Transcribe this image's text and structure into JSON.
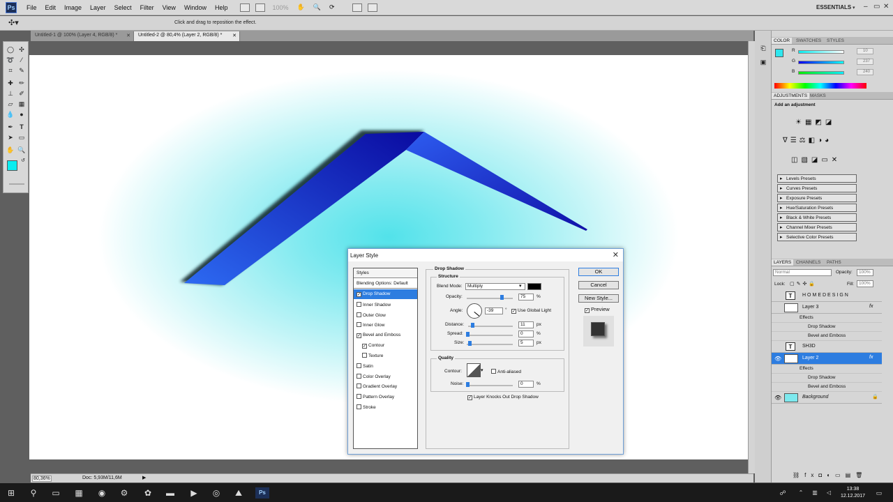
{
  "app": {
    "logo": "Ps",
    "workspace": "ESSENTIALS"
  },
  "menu": [
    "File",
    "Edit",
    "Image",
    "Layer",
    "Select",
    "Filter",
    "View",
    "Window",
    "Help"
  ],
  "zoom_display": "100%",
  "options_hint": "Click and drag to reposition the effect.",
  "tabs": [
    {
      "label": "Untitled-1 @ 100% (Layer 4, RGB/8) *"
    },
    {
      "label": "Untitled-2 @ 80,4% (Layer 2, RGB/8) *"
    }
  ],
  "status": {
    "zoom": "80,36%",
    "doc": "Doc: 5,93M/11,6M"
  },
  "color_panel": {
    "tabs": [
      "COLOR",
      "SWATCHES",
      "STYLES"
    ],
    "r_label": "R",
    "g_label": "G",
    "b_label": "B",
    "r": "10",
    "g": "237",
    "b": "240",
    "foreground": "#0aedf0"
  },
  "adjustments_panel": {
    "tabs": [
      "ADJUSTMENTS",
      "MASKS"
    ],
    "heading": "Add an adjustment",
    "presets": [
      "Levels Presets",
      "Curves Presets",
      "Exposure Presets",
      "Hue/Saturation Presets",
      "Black & White Presets",
      "Channel Mixer Presets",
      "Selective Color Presets"
    ]
  },
  "layers_panel": {
    "tabs": [
      "LAYERS",
      "CHANNELS",
      "PATHS"
    ],
    "blend_mode": "Normal",
    "opacity_label": "Opacity:",
    "opacity": "100%",
    "lock_label": "Lock:",
    "fill_label": "Fill:",
    "fill": "100%",
    "layers": [
      {
        "name": "HOMEDESIGN",
        "fx": ""
      },
      {
        "name": "Layer 3",
        "fx": "fx",
        "effects_label": "Effects",
        "effects": [
          "Drop Shadow",
          "Bevel and Emboss"
        ]
      },
      {
        "name": "SH3D",
        "fx": ""
      },
      {
        "name": "Layer 2",
        "fx": "fx",
        "effects_label": "Effects",
        "effects": [
          "Drop Shadow",
          "Bevel and Emboss"
        ]
      },
      {
        "name": "Background",
        "fx": ""
      }
    ]
  },
  "dialog": {
    "title": "Layer Style",
    "styles_header": "Styles",
    "blending": "Blending Options: Default",
    "styles": [
      {
        "label": "Drop Shadow",
        "checked": "✓"
      },
      {
        "label": "Inner Shadow",
        "checked": ""
      },
      {
        "label": "Outer Glow",
        "checked": ""
      },
      {
        "label": "Inner Glow",
        "checked": ""
      },
      {
        "label": "Bevel and Emboss",
        "checked": "✓"
      },
      {
        "label": "Contour",
        "checked": "✓"
      },
      {
        "label": "Texture",
        "checked": ""
      },
      {
        "label": "Satin",
        "checked": ""
      },
      {
        "label": "Color Overlay",
        "checked": ""
      },
      {
        "label": "Gradient Overlay",
        "checked": ""
      },
      {
        "label": "Pattern Overlay",
        "checked": ""
      },
      {
        "label": "Stroke",
        "checked": ""
      }
    ],
    "section": "Drop Shadow",
    "structure": "Structure",
    "blend_mode_label": "Blend Mode:",
    "blend_mode": "Multiply",
    "opacity_label": "Opacity:",
    "opacity": "75",
    "opacity_unit": "%",
    "angle_label": "Angle:",
    "angle": "-39",
    "angle_unit": "°",
    "global_light_label": "Use Global Light",
    "distance_label": "Distance:",
    "distance": "11",
    "distance_unit": "px",
    "spread_label": "Spread:",
    "spread": "0",
    "spread_unit": "%",
    "size_label": "Size:",
    "size": "5",
    "size_unit": "px",
    "quality": "Quality",
    "contour_label": "Contour:",
    "anti_alias_label": "Anti-aliased",
    "noise_label": "Noise:",
    "noise": "0",
    "noise_unit": "%",
    "knocks_out_label": "Layer Knocks Out Drop Shadow",
    "ok": "OK",
    "cancel": "Cancel",
    "new_style": "New Style...",
    "preview": "Preview"
  },
  "clock": {
    "time": "13:38",
    "date": "12.12.2017"
  }
}
